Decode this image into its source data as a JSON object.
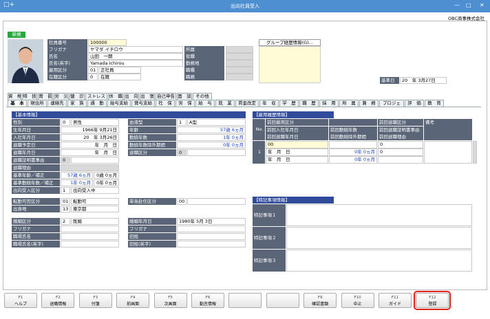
{
  "window": {
    "title": "出向社員受入",
    "app_icon": "□+",
    "min": "—",
    "max": "□",
    "close": "✕"
  },
  "company": "OBC商事株式会社",
  "status_badge": "新規",
  "group_button": "グループ経歴情報(G)...",
  "base_date": {
    "label": "基準日",
    "value": "20　年 3月27日"
  },
  "header_fields": [
    {
      "label": "社員番号",
      "value": "100000"
    },
    {
      "label": "フリガナ",
      "value": "ヤマダ イチロウ"
    },
    {
      "label": "氏名",
      "value": "山田　一朗"
    },
    {
      "label": "氏名(英字)",
      "value": "Yamada Ichirou"
    },
    {
      "label": "雇用区分",
      "code": "01",
      "value": "正社員"
    },
    {
      "label": "在籍区分",
      "code": "0",
      "value": "在籍"
    }
  ],
  "header_right": [
    "所属",
    "役職",
    "勤務地",
    "職種",
    "職務"
  ],
  "tabs_row1": [
    "資　格",
    "特　技",
    "賞　罰",
    "労　災",
    "健　診",
    "ストレス",
    "休　職",
    "出　向",
    "出　張",
    "自己申告",
    "面　談",
    "その他"
  ],
  "tabs_row2": [
    "基　本",
    "現住所",
    "連絡先",
    "家　族",
    "通　勤",
    "給与支給",
    "賞与支給",
    "社　保",
    "労　保",
    "給　与",
    "就　業",
    "賃金改定",
    "年　収",
    "学　歴",
    "職　歴",
    "採　用",
    "所　属",
    "兼　務",
    "プロジェ",
    "評　価",
    "教　育"
  ],
  "basic_info": {
    "title": "【基本情報】",
    "rows": [
      {
        "label": "性別",
        "code": "0",
        "value": "男性"
      },
      {
        "label": "生年月日",
        "value": "1966年 9月21日"
      },
      {
        "label": "入社年月日",
        "value": "20　年 3月26日"
      },
      {
        "label": "退職予定日",
        "value": "年　月　日"
      },
      {
        "label": "退職年月日",
        "value": "年　月　日"
      },
      {
        "label": "退職証明書事由",
        "code": "0",
        "value": ""
      },
      {
        "label": "退職理由",
        "value": ""
      },
      {
        "label": "基準年齢／補正",
        "value": "57歳 6ヵ月",
        "value2": "0歳 0ヵ月"
      },
      {
        "label": "基準勤続年数／補正",
        "value": "1年 0ヵ月",
        "value2": "0年 0ヵ月"
      },
      {
        "label": "出向受入区分",
        "code": "1",
        "value": "出向受入中"
      }
    ],
    "right_rows": [
      {
        "label": "血液型",
        "code": "1",
        "value": "A型"
      },
      {
        "label": "年齢",
        "value": "57歳 6ヵ月"
      },
      {
        "label": "勤続年数",
        "value": "1年 0ヵ月"
      },
      {
        "label": "勤続年数除外期間",
        "value": "0年 0ヵ月"
      },
      {
        "label": "退職区分",
        "code": "0",
        "value": ""
      }
    ]
  },
  "transfer": [
    {
      "label": "転勤可否区分",
      "code": "01",
      "value": "転勤可"
    },
    {
      "label": "出身地",
      "code": "13",
      "value": "東京都"
    }
  ],
  "transfer_right": {
    "label": "単身赴任区分",
    "code": "00",
    "value": ""
  },
  "marriage": [
    {
      "label": "婚姻区分",
      "code": "2",
      "value": "既婚"
    },
    {
      "label": "フリガナ",
      "value": ""
    },
    {
      "label": "職場氏名",
      "value": ""
    },
    {
      "label": "職場氏名(英字)",
      "value": ""
    }
  ],
  "marriage_right": [
    {
      "label": "婚姻年月日",
      "value": "1980年 5月 3日"
    },
    {
      "label": "フリガナ",
      "value": ""
    },
    {
      "label": "旧姓",
      "value": ""
    },
    {
      "label": "旧姓(英字)",
      "value": ""
    }
  ],
  "employment_history": {
    "title": "【雇用履歴情報】",
    "no_label": "No.",
    "col_a": [
      "前回雇用区分",
      "前回入社年月日",
      "前回退職年月日"
    ],
    "col_b": [
      "",
      "前回勤続年数",
      "前回勤続除外期間"
    ],
    "col_c": [
      "前回退職区分",
      "前回退職証明書事由",
      "前回退職理由"
    ],
    "remarks": "備考",
    "row_no": "1",
    "row_a": [
      "00",
      "年　月　日",
      "年　月　日"
    ],
    "row_b": [
      "",
      "0年 0ヵ月",
      "0年 0ヵ月"
    ],
    "row_c": [
      "0",
      "0",
      ""
    ]
  },
  "special_notes": {
    "title": "【特記事項情報】",
    "items": [
      "特記事項１",
      "特記事項２",
      "特記事項３"
    ]
  },
  "fkeys": [
    {
      "key": "F1",
      "label": "ヘルプ"
    },
    {
      "key": "F2",
      "label": "退職情報"
    },
    {
      "key": "F3",
      "label": "付箋"
    },
    {
      "key": "F4",
      "label": "前画面"
    },
    {
      "key": "F5",
      "label": "次画面"
    },
    {
      "key": "F6",
      "label": "勤怠情報"
    },
    {
      "key": "",
      "label": ""
    },
    {
      "key": "",
      "label": ""
    },
    {
      "key": "F9",
      "label": "確認書類"
    },
    {
      "key": "F10",
      "label": "中止"
    },
    {
      "key": "F11",
      "label": "ガイド"
    },
    {
      "key": "F12",
      "label": "登録"
    }
  ]
}
